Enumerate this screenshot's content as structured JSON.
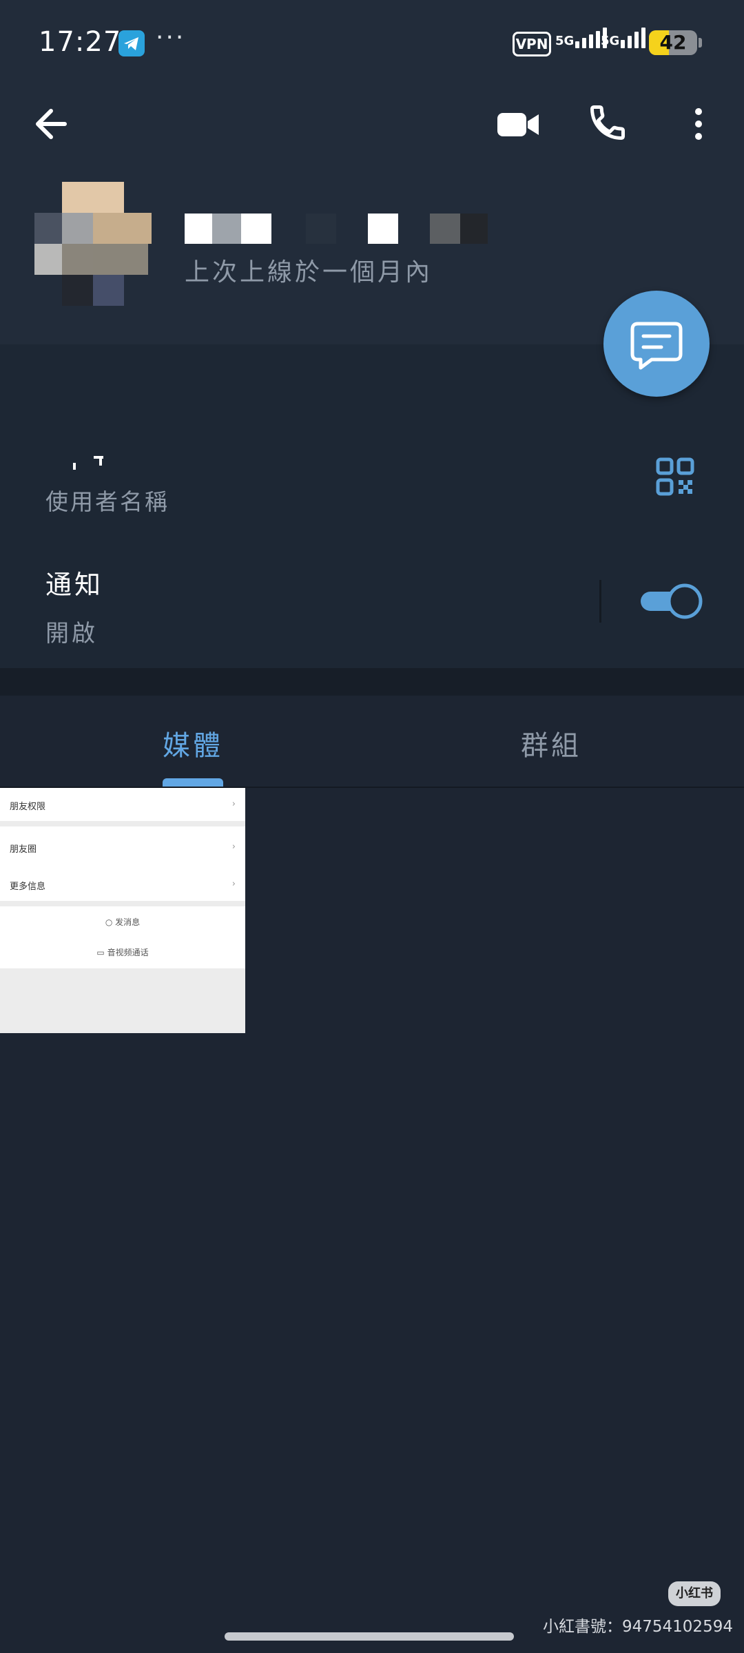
{
  "status_bar": {
    "time": "17:27",
    "more": "···",
    "vpn": "VPN",
    "net1": "5G",
    "net2": "5G",
    "battery": "42",
    "battery_level": 0.42
  },
  "profile": {
    "last_seen": "上次上線於一個月內"
  },
  "info": {
    "username_label": "使用者名稱",
    "notifications_title": "通知",
    "notifications_state": "開啟",
    "notifications_on": true
  },
  "tabs": [
    {
      "label": "媒體",
      "active": true
    },
    {
      "label": "群組",
      "active": false
    }
  ],
  "thumbnail": {
    "rows": [
      {
        "text": "朋友权限"
      },
      {
        "text": "朋友圈"
      },
      {
        "text": "更多信息"
      }
    ],
    "actions": [
      "发消息",
      "音视频通话"
    ]
  },
  "watermark": {
    "logo": "小红书",
    "id_text": "小紅書號：94754102594"
  },
  "colors": {
    "accent": "#62a7e4",
    "fab": "#5aa0d8",
    "header_bg": "#222c3a",
    "page_bg": "#1d2532"
  }
}
